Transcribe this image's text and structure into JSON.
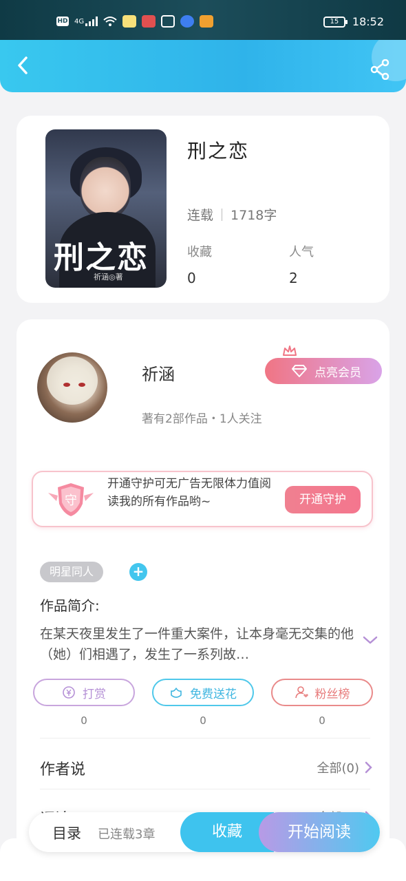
{
  "status_bar": {
    "network": "4G",
    "hd": "HD",
    "battery": "15",
    "time": "18:52"
  },
  "book": {
    "cover_title": "刑之恋",
    "cover_author": "祈涵◎著",
    "title": "刑之恋",
    "status": "连载",
    "word_count": "1718字",
    "favorites_label": "收藏",
    "favorites_value": "0",
    "popularity_label": "人气",
    "popularity_value": "2"
  },
  "author": {
    "name": "祈涵",
    "summary": "著有2部作品・1人关注",
    "vip_button": "点亮会员"
  },
  "guard": {
    "badge": "守",
    "text": "开通守护可无广告无限体力值阅读我的所有作品哟~",
    "button": "开通守护"
  },
  "tags": [
    "明星同人"
  ],
  "intro": {
    "label": "作品简介:",
    "text": "在某天夜里发生了一件重大案件，让本身毫无交集的他（她）们相遇了，发生了一系列故…"
  },
  "actions": [
    {
      "label": "打赏",
      "count": "0",
      "icon": "coin-icon",
      "color": "#b590d6"
    },
    {
      "label": "免费送花",
      "count": "0",
      "icon": "flower-icon",
      "color": "#3fb6e0"
    },
    {
      "label": "粉丝榜",
      "count": "0",
      "icon": "fans-icon",
      "color": "#e77b7b"
    }
  ],
  "author_says": {
    "label": "作者说",
    "link": "全部(0)"
  },
  "next_section": {
    "label": "评论",
    "link": "全部(0)"
  },
  "bottom_bar": {
    "toc": "目录",
    "chapters": "已连载3章",
    "favorite": "收藏",
    "start_reading": "开始阅读"
  },
  "colors": {
    "accent": "#3ec3ee",
    "vip_start": "#f07584",
    "vip_end": "#d9a3e8"
  }
}
